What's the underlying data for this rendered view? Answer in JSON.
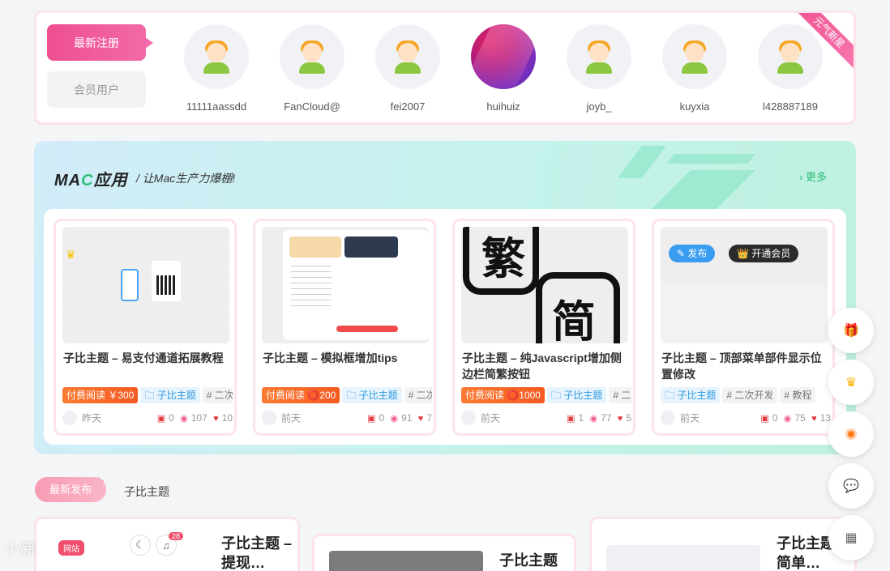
{
  "members": {
    "tab_new": "最新注册",
    "tab_members": "会员用户",
    "ribbon": "元气新星",
    "users": [
      {
        "name": "11111aassdd",
        "photo": false
      },
      {
        "name": "FanCloud@",
        "photo": false
      },
      {
        "name": "fei2007",
        "photo": false
      },
      {
        "name": "huihuiz",
        "photo": true
      },
      {
        "name": "joyb_",
        "photo": false
      },
      {
        "name": "kuyxia",
        "photo": false
      },
      {
        "name": "l428887189",
        "photo": false
      }
    ]
  },
  "mac": {
    "title_pre": "MA",
    "title_c": "C",
    "title_post": "应用",
    "subtitle": "/ 让Mac生产力爆棚!",
    "more": "› 更多",
    "cards": [
      {
        "title": "子比主题 – 易支付通道拓展教程",
        "tags": [
          {
            "type": "paid",
            "text": "付费阅读 ￥300"
          },
          {
            "type": "cat",
            "text": "🗀 子比主题"
          },
          {
            "type": "misc",
            "text": "# 二次开发"
          }
        ],
        "time": "昨天",
        "comments": "0",
        "views": "107",
        "likes": "10"
      },
      {
        "title": "子比主题 – 模拟框增加tips",
        "tags": [
          {
            "type": "paid",
            "text": "付费阅读 ⭕200"
          },
          {
            "type": "cat",
            "text": "🗀 子比主题"
          },
          {
            "type": "misc",
            "text": "# 二次开发"
          }
        ],
        "time": "前天",
        "comments": "0",
        "views": "91",
        "likes": "7"
      },
      {
        "title": "子比主题 – 纯Javascript增加侧边栏简繁按钮",
        "tags": [
          {
            "type": "paid",
            "text": "付费阅读 ⭕1000"
          },
          {
            "type": "cat",
            "text": "🗀 子比主题"
          },
          {
            "type": "misc",
            "text": "# 二次开发"
          }
        ],
        "time": "前天",
        "comments": "1",
        "views": "77",
        "likes": "5"
      },
      {
        "title": "子比主题 – 顶部菜单部件显示位置修改",
        "tags": [
          {
            "type": "cat",
            "text": "🗀 子比主题"
          },
          {
            "type": "misc",
            "text": "# 二次开发"
          },
          {
            "type": "misc",
            "text": "# 教程"
          }
        ],
        "time": "前天",
        "comments": "0",
        "views": "75",
        "likes": "13"
      }
    ],
    "thumb3": {
      "big1": "繁",
      "big2": "简"
    },
    "thumb4": {
      "pill1": "✎ 发布",
      "pill2": "👑 开通会员"
    }
  },
  "latest": {
    "tab": "最新发布",
    "sub": "子比主题",
    "cards": [
      "子比主题 – 提现…",
      "子比主题",
      "子比主题 – 简单…"
    ]
  },
  "float_icons": [
    "gift-icon",
    "crown-icon",
    "orange-dot-icon",
    "wechat-icon",
    "qrcode-icon"
  ],
  "overlay": {
    "text": "小新",
    "badge": "网站",
    "count": "28"
  },
  "colors": {
    "accent_pink": "#ee4f91",
    "accent_green": "#2ebd7a",
    "paid_orange": "#f65a22",
    "cat_blue": "#2d9ae0"
  }
}
